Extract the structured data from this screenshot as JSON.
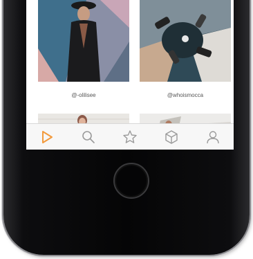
{
  "feed": {
    "posts": [
      {
        "handle": "@-olilisee"
      },
      {
        "handle": "@whoismocca"
      },
      {
        "handle": ""
      },
      {
        "handle": ""
      }
    ]
  },
  "tabbar": {
    "accent_color": "#f39a3c",
    "inactive_color": "#9a9a9a",
    "tabs": [
      {
        "icon": "play-icon",
        "active": true
      },
      {
        "icon": "search-icon",
        "active": false
      },
      {
        "icon": "star-icon",
        "active": false
      },
      {
        "icon": "box-icon",
        "active": false
      },
      {
        "icon": "profile-icon",
        "active": false
      }
    ]
  }
}
